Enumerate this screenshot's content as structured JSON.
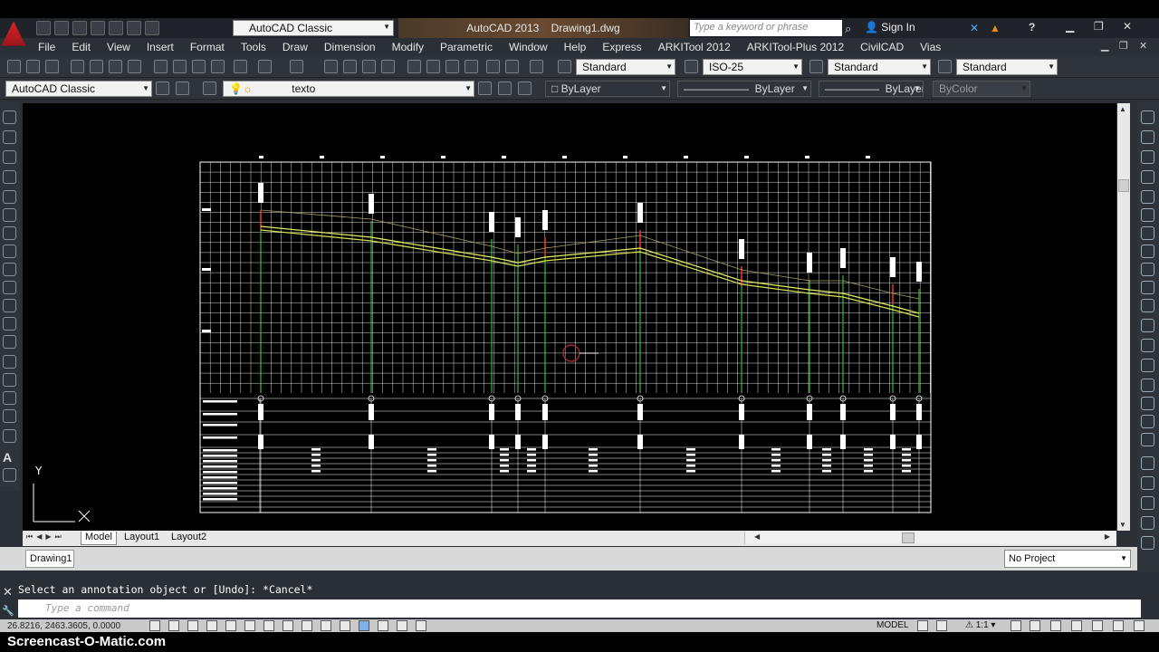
{
  "window": {
    "app_title": "AutoCAD 2013",
    "file_name": "Drawing1.dwg",
    "workspace": "AutoCAD Classic",
    "search_placeholder": "Type a keyword or phrase",
    "sign_in": "Sign In"
  },
  "menu": [
    "File",
    "Edit",
    "View",
    "Insert",
    "Format",
    "Tools",
    "Draw",
    "Dimension",
    "Modify",
    "Parametric",
    "Window",
    "Help",
    "Express",
    "ARKITool 2012",
    "ARKITool-Plus 2012",
    "CivilCAD",
    "Vias"
  ],
  "styles": {
    "text_style": "Standard",
    "dim_style": "ISO-25",
    "table_style": "Standard",
    "multileader_style": "Standard"
  },
  "layers": {
    "workspace": "AutoCAD Classic",
    "current_layer": "texto",
    "color": "ByLayer",
    "linetype": "ByLayer",
    "lineweight": "ByLayer",
    "plotstyle": "ByColor"
  },
  "layout_tabs": [
    "Model",
    "Layout1",
    "Layout2"
  ],
  "file_tab": "Drawing1",
  "project": "No Project",
  "command": {
    "history": "Select an annotation object or [Undo]: *Cancel*",
    "placeholder": "Type a command"
  },
  "status": {
    "coords": "26.8216, 2463.3605, 0.0000",
    "model": "MODEL",
    "scale": "1:1"
  },
  "watermark": "Screencast-O-Matic.com",
  "profile_table": {
    "row_labels": [
      "Numero o clave de tuberia (m)",
      "Cota terreno en eje de camara (m)",
      "Cota fondo en eje de camara (m)",
      "Longitud (m)",
      "Pendiente (%)",
      "Diametro interno (cm)",
      "Diametro Nominal (cm)",
      "Caudal (l/s)",
      "Observacion",
      "Clase de tuberia",
      "Clase de obra",
      "Clase de ambiente",
      "Clase de boca"
    ]
  },
  "colors": {
    "canvas": "#000000",
    "grid": "#ffffff",
    "terrain_line": "#d8e050",
    "pipe_line": "#e8f060",
    "manhole_green": "#30c030",
    "manhole_red": "#e03020"
  }
}
